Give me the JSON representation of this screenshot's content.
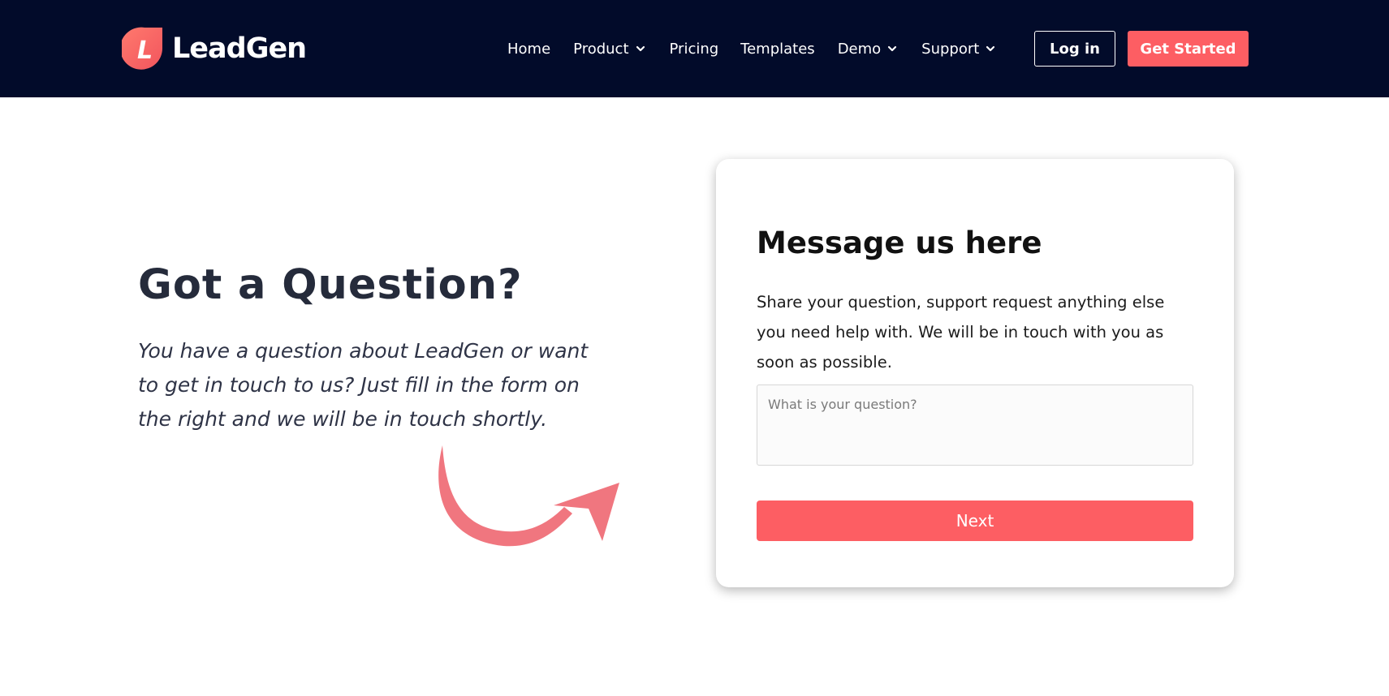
{
  "header": {
    "logo_text": "LeadGen",
    "logo_letter": "L",
    "nav": [
      {
        "label": "Home"
      },
      {
        "label": "Product"
      },
      {
        "label": "Pricing"
      },
      {
        "label": "Templates"
      },
      {
        "label": "Demo"
      },
      {
        "label": "Support"
      }
    ],
    "login_label": "Log in",
    "get_started_label": "Get Started"
  },
  "hero": {
    "title": "Got a Question?",
    "text": "You have a question about LeadGen or want to get in touch to us? Just fill in the form on the right and we will be in touch shortly."
  },
  "form": {
    "title": "Message us here",
    "description": "Share your question, support request anything else you need help with. We will be in touch with you as soon as possible.",
    "question_placeholder": "What is your question?",
    "question_value": "",
    "next_label": "Next"
  },
  "colors": {
    "header_bg": "#020b2a",
    "accent": "#fd5e63",
    "heading": "#252b3b"
  },
  "icons": {
    "logo": "leadgen-logo-icon",
    "dropdown": "chevron-down-icon",
    "arrow": "curved-arrow-icon"
  }
}
